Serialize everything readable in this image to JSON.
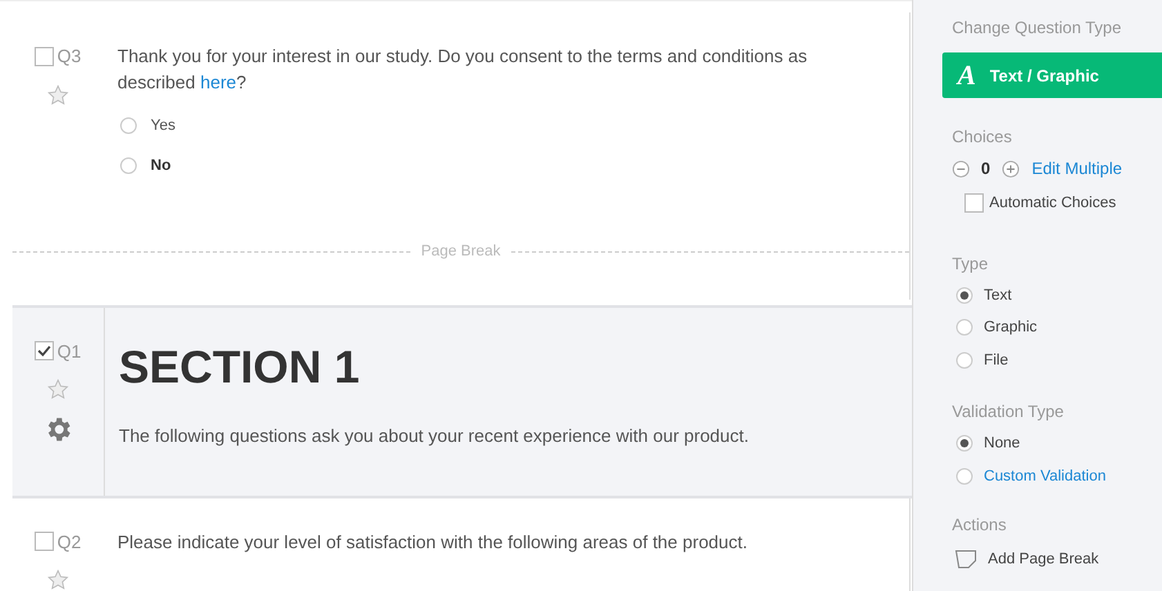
{
  "blocks": [
    {
      "kind": "question",
      "number": "Q3",
      "checked": false,
      "text_before": "Thank you for your interest in our study. Do you consent to the terms and conditions as described ",
      "link": "here",
      "text_after": "?",
      "choices": [
        {
          "label": "Yes",
          "selected": false,
          "bold": false
        },
        {
          "label": "No",
          "selected": false,
          "bold": true
        }
      ],
      "page_break": "Page Break"
    },
    {
      "kind": "section",
      "number": "Q1",
      "checked": true,
      "heading": "SECTION 1",
      "text": "The following questions ask you about your recent experience with our product."
    },
    {
      "kind": "question",
      "number": "Q2",
      "checked": false,
      "text_before": "Please indicate your level of satisfaction with the following areas of the product."
    }
  ],
  "panel": {
    "change_type_label": "Change Question Type",
    "type_icon": "A",
    "type_button": "Text / Graphic",
    "choices_label": "Choices",
    "choices_count": "0",
    "edit_multiple": "Edit Multiple",
    "automatic_choices": {
      "label": "Automatic Choices",
      "checked": false
    },
    "type_label": "Type",
    "types": [
      {
        "label": "Text",
        "selected": true
      },
      {
        "label": "Graphic",
        "selected": false
      },
      {
        "label": "File",
        "selected": false
      }
    ],
    "validation_label": "Validation Type",
    "validations": [
      {
        "label": "None",
        "selected": true,
        "link": false
      },
      {
        "label": "Custom Validation",
        "selected": false,
        "link": true
      }
    ],
    "actions_label": "Actions",
    "actions": [
      "Add Page Break"
    ]
  }
}
